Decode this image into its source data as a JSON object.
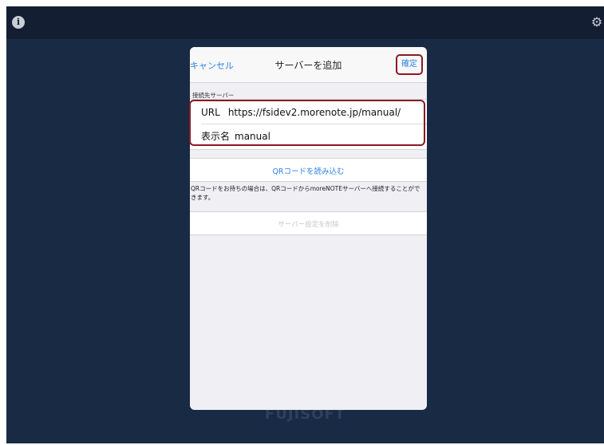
{
  "icons": {
    "info": "info-icon",
    "settings": "gear-icon"
  },
  "background": {
    "brand": "FUJISOFT"
  },
  "dialog": {
    "cancel_label": "キャンセル",
    "title": "サーバーを追加",
    "confirm_label": "確定",
    "section_header": "接続先サーバー",
    "url_label": "URL",
    "url_value": "https://fsidev2.morenote.jp/manual/",
    "name_label": "表示名",
    "name_value": "manual",
    "qr_button": "QRコードを読み込む",
    "qr_note": "QRコードをお持ちの場合は、QRコードからmoreNOTEサーバーへ接続することができます。",
    "delete_button": "サーバー設定を削除"
  },
  "colors": {
    "background": "#192a45",
    "top_bar": "#131e33",
    "accent": "#2a83e8",
    "highlight_border": "#8b1a24",
    "disabled_text": "#c7c7cc"
  }
}
